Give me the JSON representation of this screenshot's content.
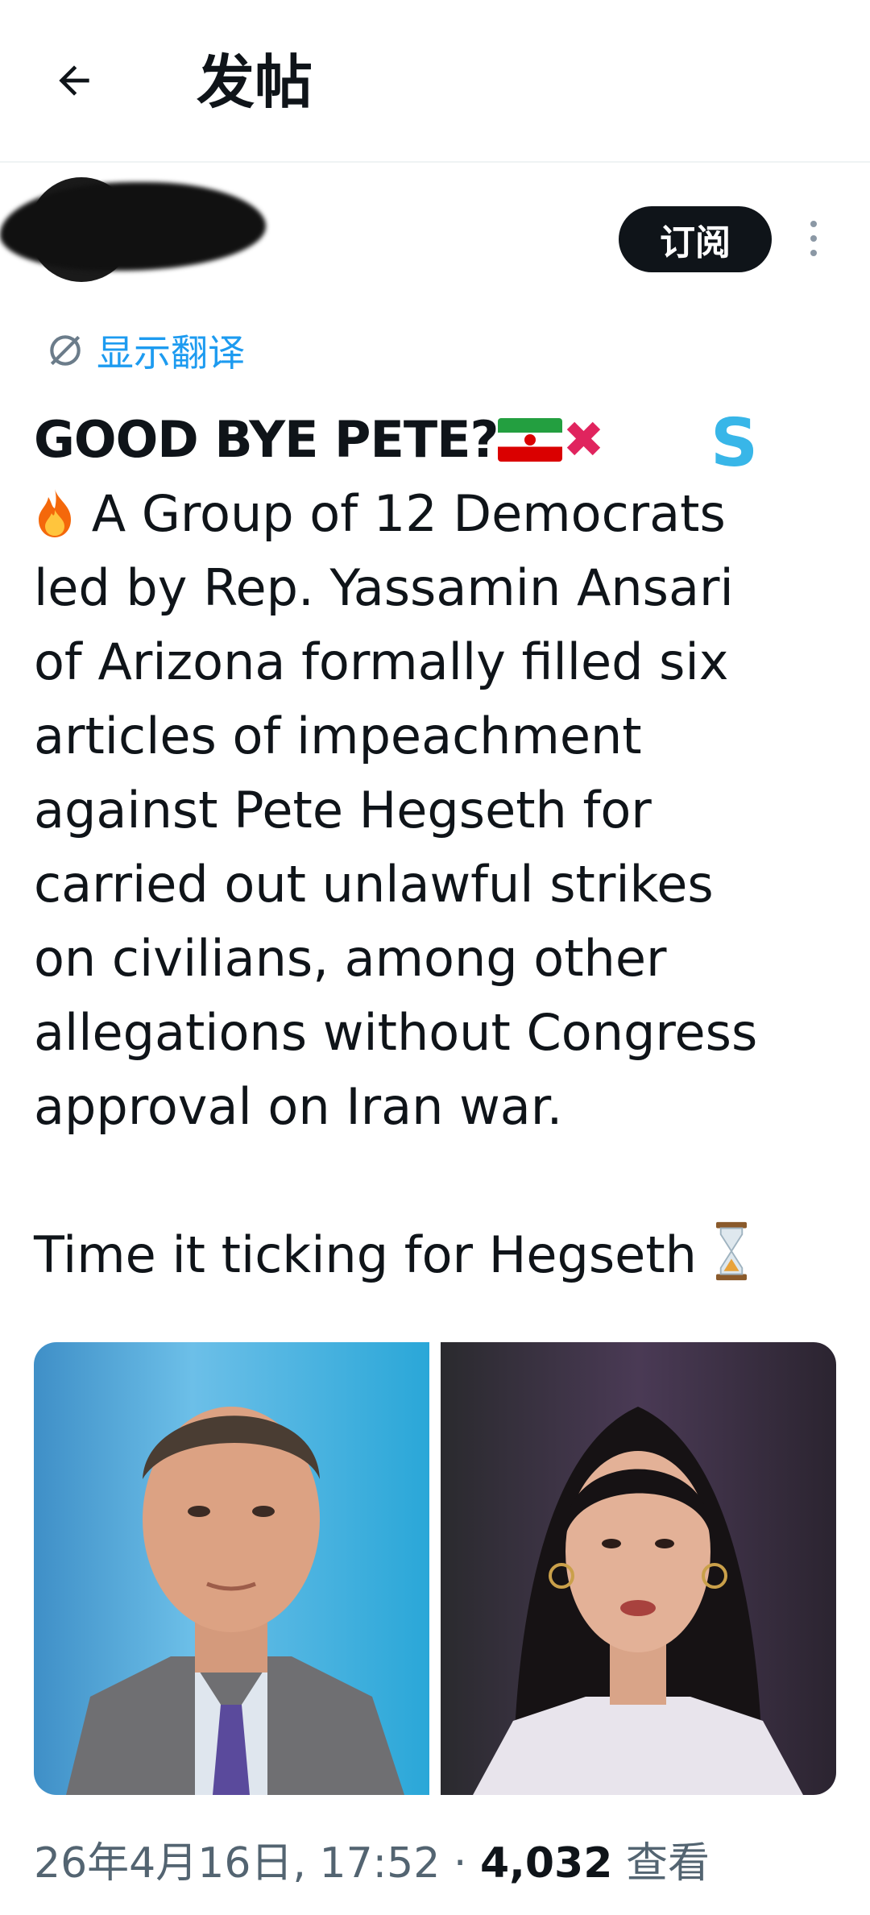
{
  "header": {
    "title": "发帖"
  },
  "author": {
    "subscribe_label": "订阅"
  },
  "translate": {
    "label": "显示翻译"
  },
  "tweet": {
    "headline": "GOOD BYE PETE?",
    "lines": [
      "A Group of 12 Democrats",
      "led by Rep. Yassamin Ansari",
      "of Arizona formally filled six",
      "articles of impeachment",
      "against Pete Hegseth for",
      "carried out unlawful strikes",
      "on civilians, among other",
      "allegations without Congress",
      "approval on Iran war."
    ],
    "closing": "Time it ticking for Hegseth",
    "s_logo": "S"
  },
  "meta": {
    "date": "26年4月16日, 17:52 · ",
    "views": "4,032",
    "views_label": " 查看"
  },
  "colors": {
    "accent": "#1d9bf0",
    "text": "#0f1419",
    "muted": "#536471"
  }
}
